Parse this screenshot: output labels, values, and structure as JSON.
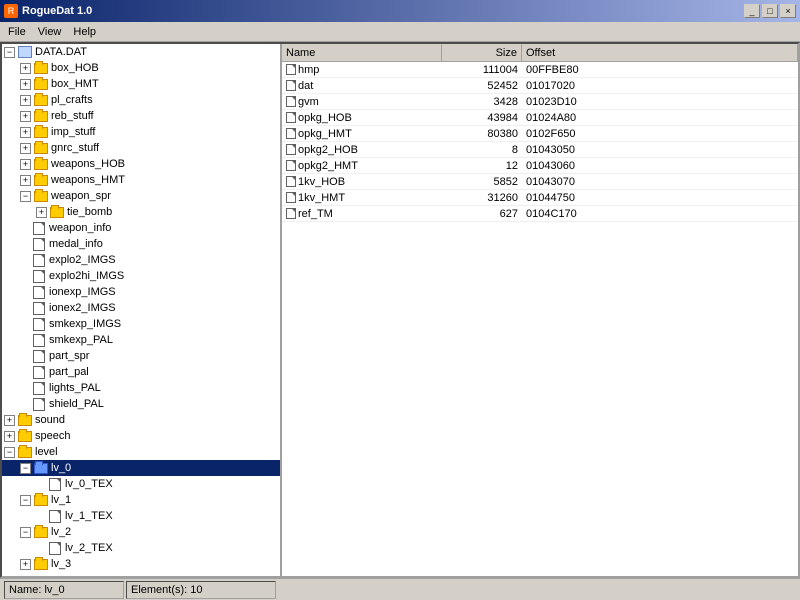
{
  "titleBar": {
    "title": "RogueDat 1.0",
    "buttons": [
      "_",
      "□",
      "×"
    ]
  },
  "menuBar": {
    "items": [
      "File",
      "View",
      "Help"
    ]
  },
  "tree": {
    "items": [
      {
        "label": "DATA.DAT",
        "type": "root",
        "indent": 0,
        "expanded": true
      },
      {
        "label": "box_HOB",
        "type": "folder",
        "indent": 1,
        "expanded": false
      },
      {
        "label": "box_HMT",
        "type": "folder",
        "indent": 1,
        "expanded": false
      },
      {
        "label": "pl_crafts",
        "type": "folder",
        "indent": 1,
        "expanded": false
      },
      {
        "label": "reb_stuff",
        "type": "folder",
        "indent": 1,
        "expanded": false
      },
      {
        "label": "imp_stuff",
        "type": "folder",
        "indent": 1,
        "expanded": false
      },
      {
        "label": "gnrc_stuff",
        "type": "folder",
        "indent": 1,
        "expanded": false
      },
      {
        "label": "weapons_HOB",
        "type": "folder",
        "indent": 1,
        "expanded": false
      },
      {
        "label": "weapons_HMT",
        "type": "folder",
        "indent": 1,
        "expanded": false
      },
      {
        "label": "weapon_spr",
        "type": "folder",
        "indent": 1,
        "expanded": true
      },
      {
        "label": "tie_bomb",
        "type": "folder",
        "indent": 2,
        "expanded": false
      },
      {
        "label": "weapon_info",
        "type": "file",
        "indent": 1
      },
      {
        "label": "medal_info",
        "type": "file",
        "indent": 1
      },
      {
        "label": "explo2_IMGS",
        "type": "file",
        "indent": 1
      },
      {
        "label": "explo2hi_IMGS",
        "type": "file",
        "indent": 1
      },
      {
        "label": "ionexp_IMGS",
        "type": "file",
        "indent": 1
      },
      {
        "label": "ionex2_IMGS",
        "type": "file",
        "indent": 1
      },
      {
        "label": "smkexp_IMGS",
        "type": "file",
        "indent": 1
      },
      {
        "label": "smkexp_PAL",
        "type": "file",
        "indent": 1
      },
      {
        "label": "part_spr",
        "type": "file",
        "indent": 1
      },
      {
        "label": "part_pal",
        "type": "file",
        "indent": 1
      },
      {
        "label": "lights_PAL",
        "type": "file",
        "indent": 1
      },
      {
        "label": "shield_PAL",
        "type": "file",
        "indent": 1
      },
      {
        "label": "sound",
        "type": "folder",
        "indent": 0,
        "expanded": false
      },
      {
        "label": "speech",
        "type": "folder",
        "indent": 0,
        "expanded": false
      },
      {
        "label": "level",
        "type": "folder",
        "indent": 0,
        "expanded": true
      },
      {
        "label": "lv_0",
        "type": "folder",
        "indent": 1,
        "expanded": true,
        "selected": true
      },
      {
        "label": "lv_0_TEX",
        "type": "file",
        "indent": 2
      },
      {
        "label": "lv_1",
        "type": "folder",
        "indent": 1,
        "expanded": true
      },
      {
        "label": "lv_1_TEX",
        "type": "file",
        "indent": 2
      },
      {
        "label": "lv_2",
        "type": "folder",
        "indent": 1,
        "expanded": true
      },
      {
        "label": "lv_2_TEX",
        "type": "file",
        "indent": 2
      },
      {
        "label": "lv_3",
        "type": "folder",
        "indent": 1,
        "expanded": false
      }
    ]
  },
  "listView": {
    "columns": [
      "Name",
      "Size",
      "Offset"
    ],
    "rows": [
      {
        "name": "hmp",
        "size": "111004",
        "offset": "00FFBE80"
      },
      {
        "name": "dat",
        "size": "52452",
        "offset": "01017020"
      },
      {
        "name": "gvm",
        "size": "3428",
        "offset": "01023D10"
      },
      {
        "name": "opkg_HOB",
        "size": "43984",
        "offset": "01024A80"
      },
      {
        "name": "opkg_HMT",
        "size": "80380",
        "offset": "0102F650"
      },
      {
        "name": "opkg2_HOB",
        "size": "8",
        "offset": "01043050"
      },
      {
        "name": "opkg2_HMT",
        "size": "12",
        "offset": "01043060"
      },
      {
        "name": "1kv_HOB",
        "size": "5852",
        "offset": "01043070"
      },
      {
        "name": "1kv_HMT",
        "size": "31260",
        "offset": "01044750"
      },
      {
        "name": "ref_TM",
        "size": "627",
        "offset": "0104C170"
      }
    ]
  },
  "statusBar": {
    "left": "Name: lv_0",
    "right": "Element(s): 10"
  }
}
